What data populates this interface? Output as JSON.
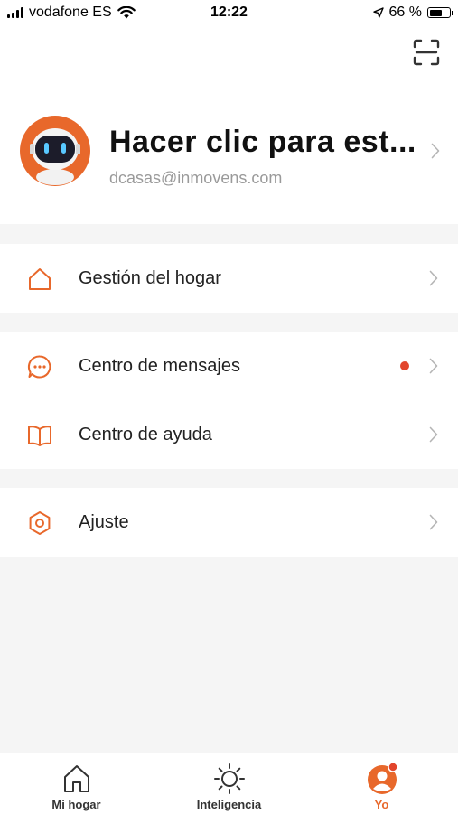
{
  "status_bar": {
    "carrier": "vodafone ES",
    "time": "12:22",
    "battery": "66 %",
    "battery_level": 0.66
  },
  "profile": {
    "name": "Hacer clic para est...",
    "email": "dcasas@inmovens.com"
  },
  "menu": {
    "home_management": "Gestión del hogar",
    "message_center": "Centro de mensajes",
    "help_center": "Centro de ayuda",
    "settings": "Ajuste"
  },
  "tabs": [
    {
      "label": "Mi hogar",
      "icon": "home-icon"
    },
    {
      "label": "Inteligencia",
      "icon": "sun-icon"
    },
    {
      "label": "Yo",
      "icon": "user-icon",
      "active": true
    }
  ],
  "colors": {
    "accent": "#e8682b",
    "notification_dot": "#e2452c",
    "background": "#f5f5f5"
  }
}
